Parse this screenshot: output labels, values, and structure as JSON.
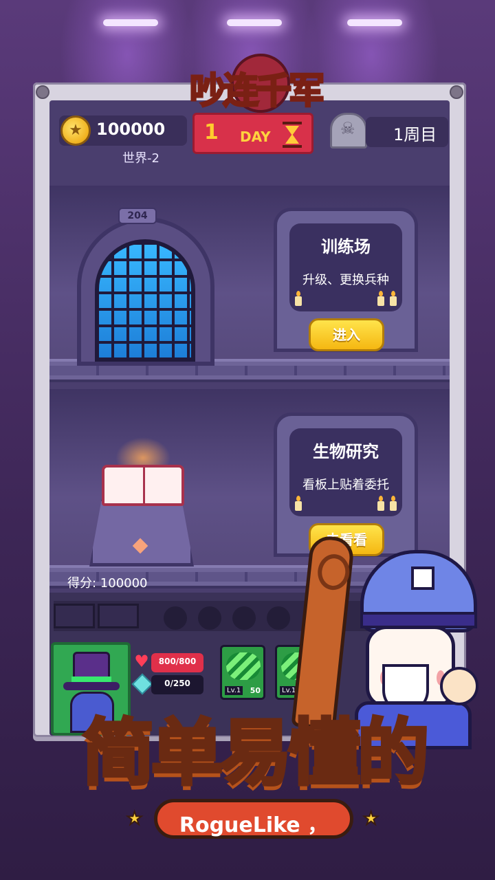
{
  "logo": {
    "title": "吵连千军"
  },
  "header": {
    "coins": "100000",
    "world": "世界-2",
    "day": {
      "number": "1",
      "label": "DAY"
    },
    "round": "1周目"
  },
  "room_door": {
    "plate": "204"
  },
  "training": {
    "title": "训练场",
    "subtitle": "升级、更换兵种",
    "button": "进入"
  },
  "research": {
    "title": "生物研究",
    "subtitle": "看板上贴着委托",
    "button": "去看看"
  },
  "score": "得分: 100000",
  "hero": {
    "hp": "800/800",
    "hp_fraction": 1.0,
    "mana": "0/250",
    "mana_fraction": 0.0
  },
  "skills": [
    {
      "level": "Lv.1",
      "value": "50"
    },
    {
      "level": "Lv.1",
      "value": ""
    }
  ],
  "promo": {
    "headline": "简单易懂的",
    "tagline": "RogueLike ，"
  }
}
